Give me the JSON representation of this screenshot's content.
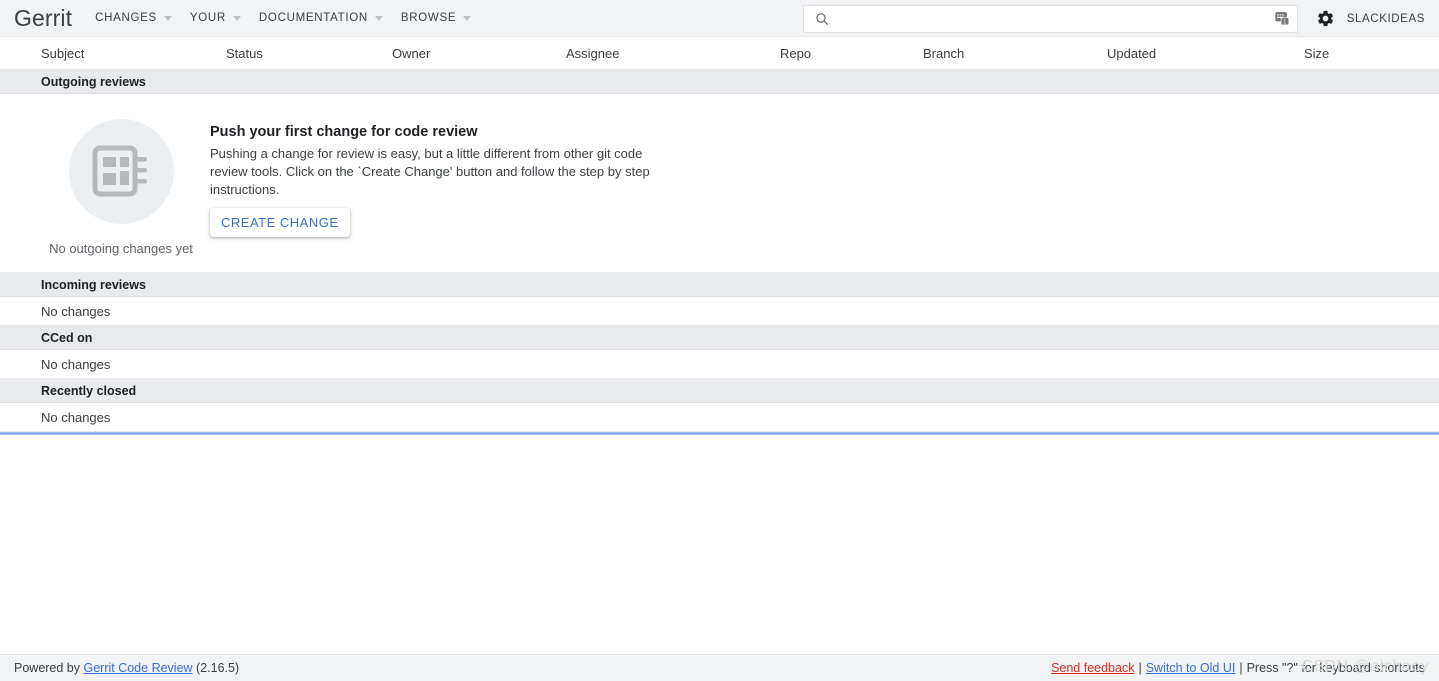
{
  "header": {
    "brand": "Gerrit",
    "nav": [
      {
        "label": "CHANGES",
        "icon": "chevron-down-icon"
      },
      {
        "label": "YOUR",
        "icon": "chevron-down-icon"
      },
      {
        "label": "DOCUMENTATION",
        "icon": "chevron-down-icon"
      },
      {
        "label": "BROWSE",
        "icon": "chevron-down-icon"
      }
    ],
    "search": {
      "value": "",
      "placeholder": "",
      "icon": "search-icon"
    },
    "keyboard_icon": "keyboard-shortcuts-icon",
    "gear_icon": "gear-icon",
    "account": "SLACKIDEAS"
  },
  "table": {
    "columns": [
      "Subject",
      "Status",
      "Owner",
      "Assignee",
      "Repo",
      "Branch",
      "Updated",
      "Size"
    ]
  },
  "sections": [
    {
      "title": "Outgoing reviews",
      "type": "empty-state",
      "empty_state": {
        "icon": "dashboard-placeholder-icon",
        "caption": "No outgoing changes yet",
        "title": "Push your first change for code review",
        "body": "Pushing a change for review is easy, but a little different from other git code review tools. Click on the `Create Change' button and follow the step by step instructions.",
        "button": "CREATE CHANGE"
      }
    },
    {
      "title": "Incoming reviews",
      "type": "empty-row",
      "message": "No changes"
    },
    {
      "title": "CCed on",
      "type": "empty-row",
      "message": "No changes"
    },
    {
      "title": "Recently closed",
      "type": "empty-row",
      "message": "No changes"
    }
  ],
  "footer": {
    "powered_by_prefix": "Powered by ",
    "gerrit_link": "Gerrit Code Review",
    "version": " (2.16.5)",
    "send_feedback": "Send feedback",
    "separator": "|",
    "switch_old_ui": "Switch to Old UI",
    "keyboard_hint": "Press \"?\" for keyboard shortcuts"
  },
  "watermark": "CSDN @aichaoy",
  "colors": {
    "header_bg": "#f1f3f4",
    "section_bg": "#e8eaed",
    "accent_blue": "#3b6fd4",
    "loading_bar": "#7b9aea",
    "feedback_red": "#d93025"
  }
}
